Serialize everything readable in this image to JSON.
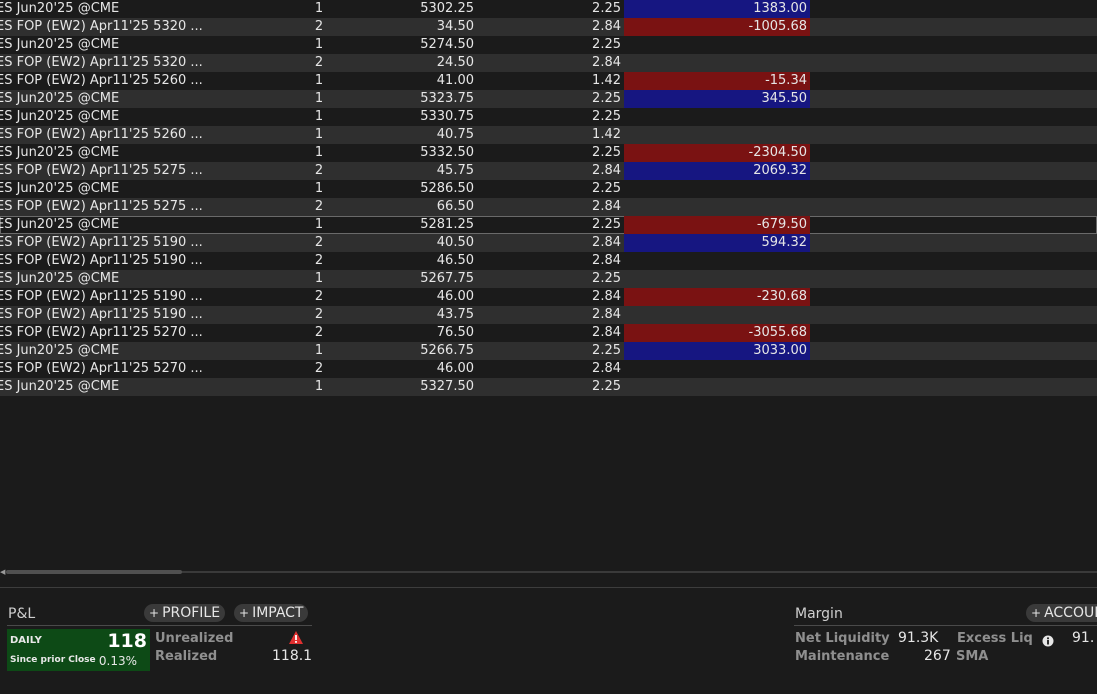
{
  "trades": [
    {
      "desc": "ES Jun20'25 @CME",
      "qty": "1",
      "price": "5302.25",
      "comm": "2.25",
      "pnl": "1383.00",
      "pnl_sign": "pos"
    },
    {
      "desc": "ES FOP (EW2) Apr11'25 5320 ...",
      "qty": "2",
      "price": "34.50",
      "comm": "2.84",
      "pnl": "-1005.68",
      "pnl_sign": "neg"
    },
    {
      "desc": "ES Jun20'25 @CME",
      "qty": "1",
      "price": "5274.50",
      "comm": "2.25",
      "pnl": "",
      "pnl_sign": ""
    },
    {
      "desc": "ES FOP (EW2) Apr11'25 5320 ...",
      "qty": "2",
      "price": "24.50",
      "comm": "2.84",
      "pnl": "",
      "pnl_sign": ""
    },
    {
      "desc": "ES FOP (EW2) Apr11'25 5260 ...",
      "qty": "1",
      "price": "41.00",
      "comm": "1.42",
      "pnl": "-15.34",
      "pnl_sign": "neg"
    },
    {
      "desc": "ES Jun20'25 @CME",
      "qty": "1",
      "price": "5323.75",
      "comm": "2.25",
      "pnl": "345.50",
      "pnl_sign": "pos"
    },
    {
      "desc": "ES Jun20'25 @CME",
      "qty": "1",
      "price": "5330.75",
      "comm": "2.25",
      "pnl": "",
      "pnl_sign": ""
    },
    {
      "desc": "ES FOP (EW2) Apr11'25 5260 ...",
      "qty": "1",
      "price": "40.75",
      "comm": "1.42",
      "pnl": "",
      "pnl_sign": ""
    },
    {
      "desc": "ES Jun20'25 @CME",
      "qty": "1",
      "price": "5332.50",
      "comm": "2.25",
      "pnl": "-2304.50",
      "pnl_sign": "neg"
    },
    {
      "desc": "ES FOP (EW2) Apr11'25 5275 ...",
      "qty": "2",
      "price": "45.75",
      "comm": "2.84",
      "pnl": "2069.32",
      "pnl_sign": "pos"
    },
    {
      "desc": "ES Jun20'25 @CME",
      "qty": "1",
      "price": "5286.50",
      "comm": "2.25",
      "pnl": "",
      "pnl_sign": ""
    },
    {
      "desc": "ES FOP (EW2) Apr11'25 5275 ...",
      "qty": "2",
      "price": "66.50",
      "comm": "2.84",
      "pnl": "",
      "pnl_sign": ""
    },
    {
      "desc": "ES Jun20'25 @CME",
      "qty": "1",
      "price": "5281.25",
      "comm": "2.25",
      "pnl": "-679.50",
      "pnl_sign": "neg"
    },
    {
      "desc": "ES FOP (EW2) Apr11'25 5190 ...",
      "qty": "2",
      "price": "40.50",
      "comm": "2.84",
      "pnl": "594.32",
      "pnl_sign": "pos"
    },
    {
      "desc": "ES FOP (EW2) Apr11'25 5190 ...",
      "qty": "2",
      "price": "46.50",
      "comm": "2.84",
      "pnl": "",
      "pnl_sign": ""
    },
    {
      "desc": "ES Jun20'25 @CME",
      "qty": "1",
      "price": "5267.75",
      "comm": "2.25",
      "pnl": "",
      "pnl_sign": ""
    },
    {
      "desc": "ES FOP (EW2) Apr11'25 5190 ...",
      "qty": "2",
      "price": "46.00",
      "comm": "2.84",
      "pnl": "-230.68",
      "pnl_sign": "neg"
    },
    {
      "desc": "ES FOP (EW2) Apr11'25 5190 ...",
      "qty": "2",
      "price": "43.75",
      "comm": "2.84",
      "pnl": "",
      "pnl_sign": ""
    },
    {
      "desc": "ES FOP (EW2) Apr11'25 5270 ...",
      "qty": "2",
      "price": "76.50",
      "comm": "2.84",
      "pnl": "-3055.68",
      "pnl_sign": "neg"
    },
    {
      "desc": "ES Jun20'25 @CME",
      "qty": "1",
      "price": "5266.75",
      "comm": "2.25",
      "pnl": "3033.00",
      "pnl_sign": "pos"
    },
    {
      "desc": "ES FOP (EW2) Apr11'25 5270 ...",
      "qty": "2",
      "price": "46.00",
      "comm": "2.84",
      "pnl": "",
      "pnl_sign": ""
    },
    {
      "desc": "ES Jun20'25 @CME",
      "qty": "1",
      "price": "5327.50",
      "comm": "2.25",
      "pnl": "",
      "pnl_sign": ""
    }
  ],
  "selected_row": 12,
  "colors": {
    "background": "#1b1b1b",
    "row_alt": "#2f2f2f",
    "loss": "#7a1212",
    "gain": "#161681",
    "daily_box": "#0d4a16"
  },
  "pnl": {
    "title": "P&L",
    "profile_button": "PROFILE",
    "impact_button": "IMPACT",
    "daily_label": "DAILY",
    "daily_value": "118",
    "since_label": "Since prior Close",
    "since_value": "0.13%",
    "unrealized_label": "Unrealized",
    "unrealized_icon": "warning-icon",
    "realized_label": "Realized",
    "realized_value": "118.1"
  },
  "margin": {
    "title": "Margin",
    "account_button": "ACCOUNT",
    "net_liquidity_label": "Net Liquidity",
    "net_liquidity_value": "91.3K",
    "excess_liq_label": "Excess Liq",
    "excess_liq_icon": "info-icon",
    "excess_liq_value": "91.",
    "maintenance_label": "Maintenance",
    "maintenance_value": "267",
    "sma_label": "SMA"
  }
}
